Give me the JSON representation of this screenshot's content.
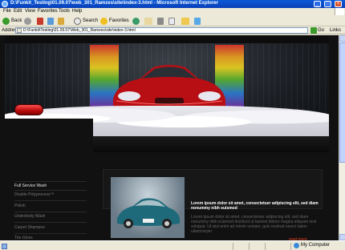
{
  "window": {
    "title": "D:\\Funkit_Testing\\01.09.07\\web_301_Ramzes\\site\\index-3.html - Microsoft Internet Explorer",
    "min_label": "_",
    "max_label": "□",
    "close_label": "×"
  },
  "menubar": {
    "items": [
      "File",
      "Edit",
      "View",
      "Favorites",
      "Tools",
      "Help"
    ]
  },
  "toolbar": {
    "back": "Back",
    "search": "Search",
    "favorites": "Favorites"
  },
  "addressbar": {
    "label": "Address",
    "url": "D:\\Funkit\\Testing\\01.09.07\\Web_301_Ramzes\\site\\index-3.html",
    "go": "Go",
    "links": "Links"
  },
  "sidebar": {
    "items": [
      {
        "label": "Full Service Wash",
        "active": true
      },
      {
        "label": "Double Polyprocess™",
        "active": false
      },
      {
        "label": "Polish",
        "active": false
      },
      {
        "label": "Underbody Wash",
        "active": false
      },
      {
        "label": "Carpet Shampoo",
        "active": false
      },
      {
        "label": "Tire Gloss",
        "active": false
      }
    ]
  },
  "article": {
    "lead": "Lorem ipsum dolor sit amet, consectetuer adipiscing elit, sed diam nonummy nibh euismod",
    "body": "Lorem ipsum dolor sit amet, consectetuer adipiscing elit, sed diam nonummy nibh euismod tincidunt ut laoreet dolore magna aliquam erat volutpat. Ut wisi enim ad minim veniam, quis nostrud exerci tation ullamcorper",
    "read_more": "read more"
  },
  "statusbar": {
    "zone": "My Computer"
  },
  "colors": {
    "accent_red": "#c81414",
    "read_more": "#e53a1a",
    "xp_blue": "#0a4fd0"
  }
}
